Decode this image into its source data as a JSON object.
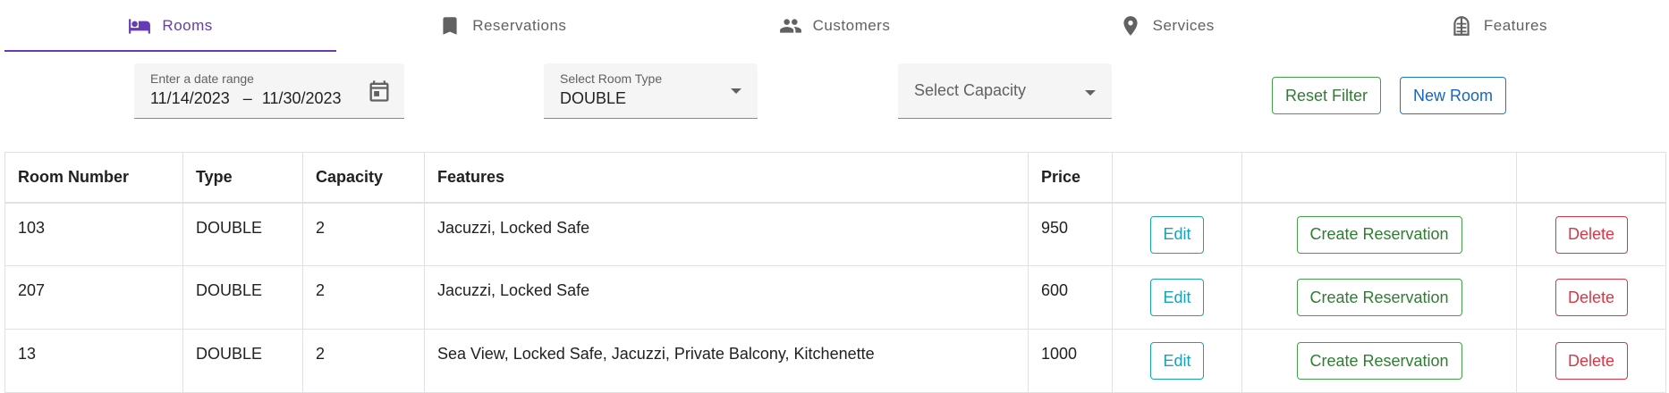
{
  "tabs": [
    {
      "label": "Rooms",
      "icon": "bed-icon",
      "active": true
    },
    {
      "label": "Reservations",
      "icon": "bookmark-icon",
      "active": false
    },
    {
      "label": "Customers",
      "icon": "people-icon",
      "active": false
    },
    {
      "label": "Services",
      "icon": "location-pin-icon",
      "active": false
    },
    {
      "label": "Features",
      "icon": "building-icon",
      "active": false
    }
  ],
  "filters": {
    "date_range": {
      "label": "Enter a date range",
      "start": "11/14/2023",
      "separator": "–",
      "end": "11/30/2023"
    },
    "room_type": {
      "label": "Select Room Type",
      "value": "DOUBLE"
    },
    "capacity": {
      "placeholder": "Select Capacity"
    },
    "reset_label": "Reset Filter",
    "new_room_label": "New Room"
  },
  "table": {
    "headers": [
      "Room Number",
      "Type",
      "Capacity",
      "Features",
      "Price",
      "",
      "",
      ""
    ],
    "rows": [
      {
        "number": "103",
        "type": "DOUBLE",
        "capacity": "2",
        "features": "Jacuzzi, Locked Safe",
        "price": "950"
      },
      {
        "number": "207",
        "type": "DOUBLE",
        "capacity": "2",
        "features": "Jacuzzi, Locked Safe",
        "price": "600"
      },
      {
        "number": "13",
        "type": "DOUBLE",
        "capacity": "2",
        "features": "Sea View, Locked Safe, Jacuzzi, Private Balcony, Kitchenette",
        "price": "1000"
      }
    ],
    "actions": {
      "edit": "Edit",
      "reserve": "Create Reservation",
      "delete": "Delete"
    }
  },
  "colors": {
    "accent": "#673ab7",
    "success": "#43a047",
    "primary": "#1976d2",
    "info": "#17a2b8",
    "danger": "#dc3545"
  }
}
